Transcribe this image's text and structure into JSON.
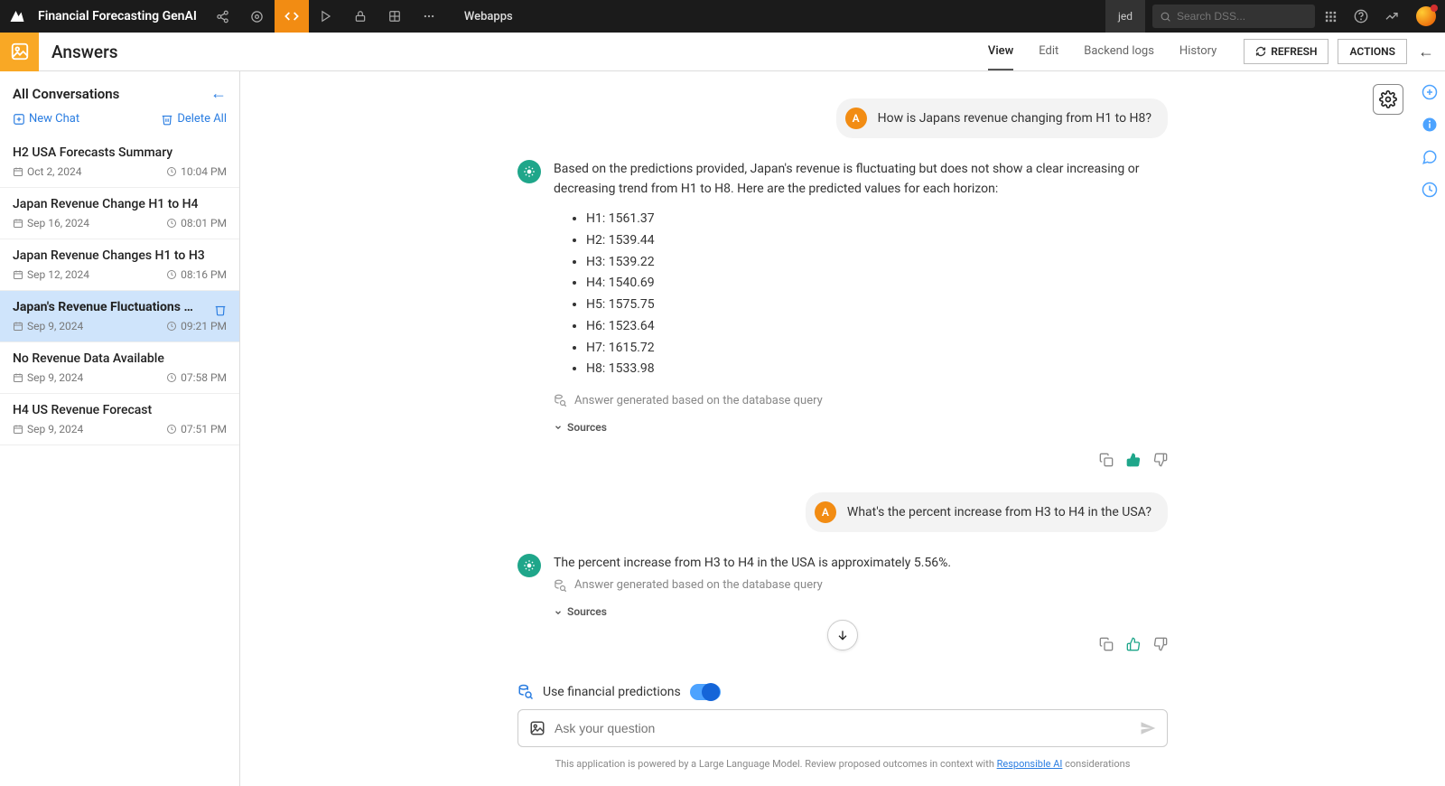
{
  "topbar": {
    "title": "Financial Forecasting GenAI",
    "breadcrumb": "Webapps",
    "user": "jed",
    "search_placeholder": "Search DSS..."
  },
  "subbar": {
    "title": "Answers",
    "tabs": [
      "View",
      "Edit",
      "Backend logs",
      "History"
    ],
    "active_tab": 0,
    "refresh": "REFRESH",
    "actions": "ACTIONS"
  },
  "sidebar": {
    "header": "All Conversations",
    "new_chat": "New Chat",
    "delete_all": "Delete All",
    "conversations": [
      {
        "title": "H2 USA Forecasts Summary",
        "date": "Oct 2, 2024",
        "time": "10:04 PM",
        "active": false
      },
      {
        "title": "Japan Revenue Change H1 to H4",
        "date": "Sep 16, 2024",
        "time": "08:01 PM",
        "active": false
      },
      {
        "title": "Japan Revenue Changes H1 to H3",
        "date": "Sep 12, 2024",
        "time": "08:16 PM",
        "active": false
      },
      {
        "title": "Japan's Revenue Fluctuations H…",
        "date": "Sep 9, 2024",
        "time": "09:21 PM",
        "active": true
      },
      {
        "title": "No Revenue Data Available",
        "date": "Sep 9, 2024",
        "time": "07:58 PM",
        "active": false
      },
      {
        "title": "H4 US Revenue Forecast",
        "date": "Sep 9, 2024",
        "time": "07:51 PM",
        "active": false
      }
    ]
  },
  "chat": {
    "user_avatar_letter": "A",
    "messages": [
      {
        "role": "user",
        "text": "How is Japans revenue changing from H1 to H8?"
      },
      {
        "role": "bot",
        "intro": "Based on the predictions provided, Japan's revenue is fluctuating but does not show a clear increasing or decreasing trend from H1 to H8. Here are the predicted values for each horizon:",
        "bullets": [
          "H1: 1561.37",
          "H2: 1539.44",
          "H3: 1539.22",
          "H4: 1540.69",
          "H5: 1575.75",
          "H6: 1523.64",
          "H7: 1615.72",
          "H8: 1533.98"
        ],
        "generated_by": "Answer generated based on the database query",
        "sources_label": "Sources"
      },
      {
        "role": "user",
        "text": "What's the percent increase from H3 to H4 in the USA?"
      },
      {
        "role": "bot",
        "intro": "The percent increase from H3 to H4 in the USA is approximately 5.56%.",
        "generated_by": "Answer generated based on the database query",
        "sources_label": "Sources"
      }
    ]
  },
  "input": {
    "toggle_label": "Use financial predictions",
    "placeholder": "Ask your question",
    "footer_pre": "This application is powered by a Large Language Model. Review proposed outcomes in context with ",
    "footer_link": "Responsible AI",
    "footer_post": " considerations"
  }
}
